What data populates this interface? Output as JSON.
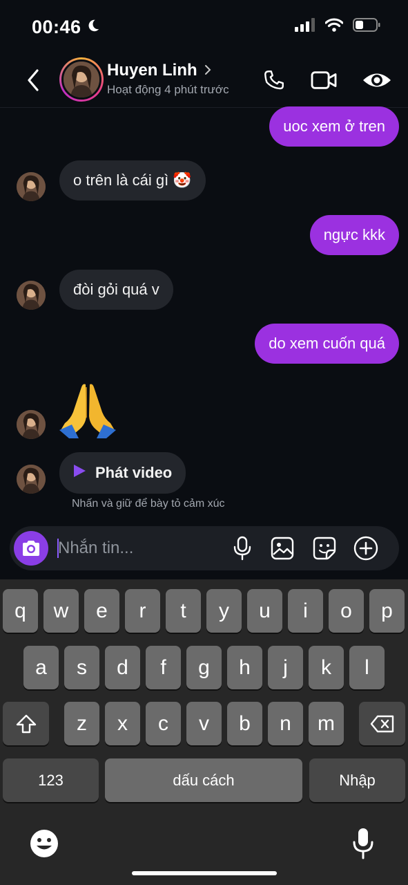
{
  "status_bar": {
    "time": "00:46",
    "moon_icon": "moon-icon",
    "signal_icon": "signal-icon",
    "wifi_icon": "wifi-icon",
    "battery_icon": "battery-icon"
  },
  "header": {
    "name": "Huyen Linh",
    "status": "Hoạt động 4 phút trước",
    "icons": [
      "back-icon",
      "chevron-right-icon",
      "phone-icon",
      "video-call-icon",
      "eye-icon"
    ]
  },
  "messages": [
    {
      "direction": "outgoing",
      "text": "uoc xem ở tren"
    },
    {
      "direction": "incoming",
      "text": "o trên là cái gì 🤡"
    },
    {
      "direction": "outgoing",
      "text": "ngực kkk"
    },
    {
      "direction": "incoming",
      "text": "đòi gỏi quá v"
    },
    {
      "direction": "outgoing",
      "text": "do xem cuốn quá"
    },
    {
      "direction": "incoming",
      "text": "🙏"
    },
    {
      "direction": "incoming",
      "text": "Phát video",
      "type": "video"
    }
  ],
  "hint": "Nhấn và giữ để bày tỏ cảm xúc",
  "composer": {
    "placeholder": "Nhắn tin...",
    "icons": [
      "camera-icon",
      "microphone-icon",
      "gallery-icon",
      "sticker-icon",
      "plus-icon"
    ]
  },
  "keyboard": {
    "row1": [
      "q",
      "w",
      "e",
      "r",
      "t",
      "y",
      "u",
      "i",
      "o",
      "p"
    ],
    "row2": [
      "a",
      "s",
      "d",
      "f",
      "g",
      "h",
      "j",
      "k",
      "l"
    ],
    "row3": [
      "z",
      "x",
      "c",
      "v",
      "b",
      "n",
      "m"
    ],
    "numbers_key": "123",
    "space_key": "dấu cách",
    "return_key": "Nhập",
    "icons": [
      "shift-icon",
      "backspace-icon",
      "emoji-icon",
      "dictation-icon"
    ]
  },
  "colors": {
    "outgoing_bubble": "#9b31e0",
    "incoming_bubble": "#23262c",
    "background": "#0a0d12",
    "accent": "#8a3ee6"
  }
}
